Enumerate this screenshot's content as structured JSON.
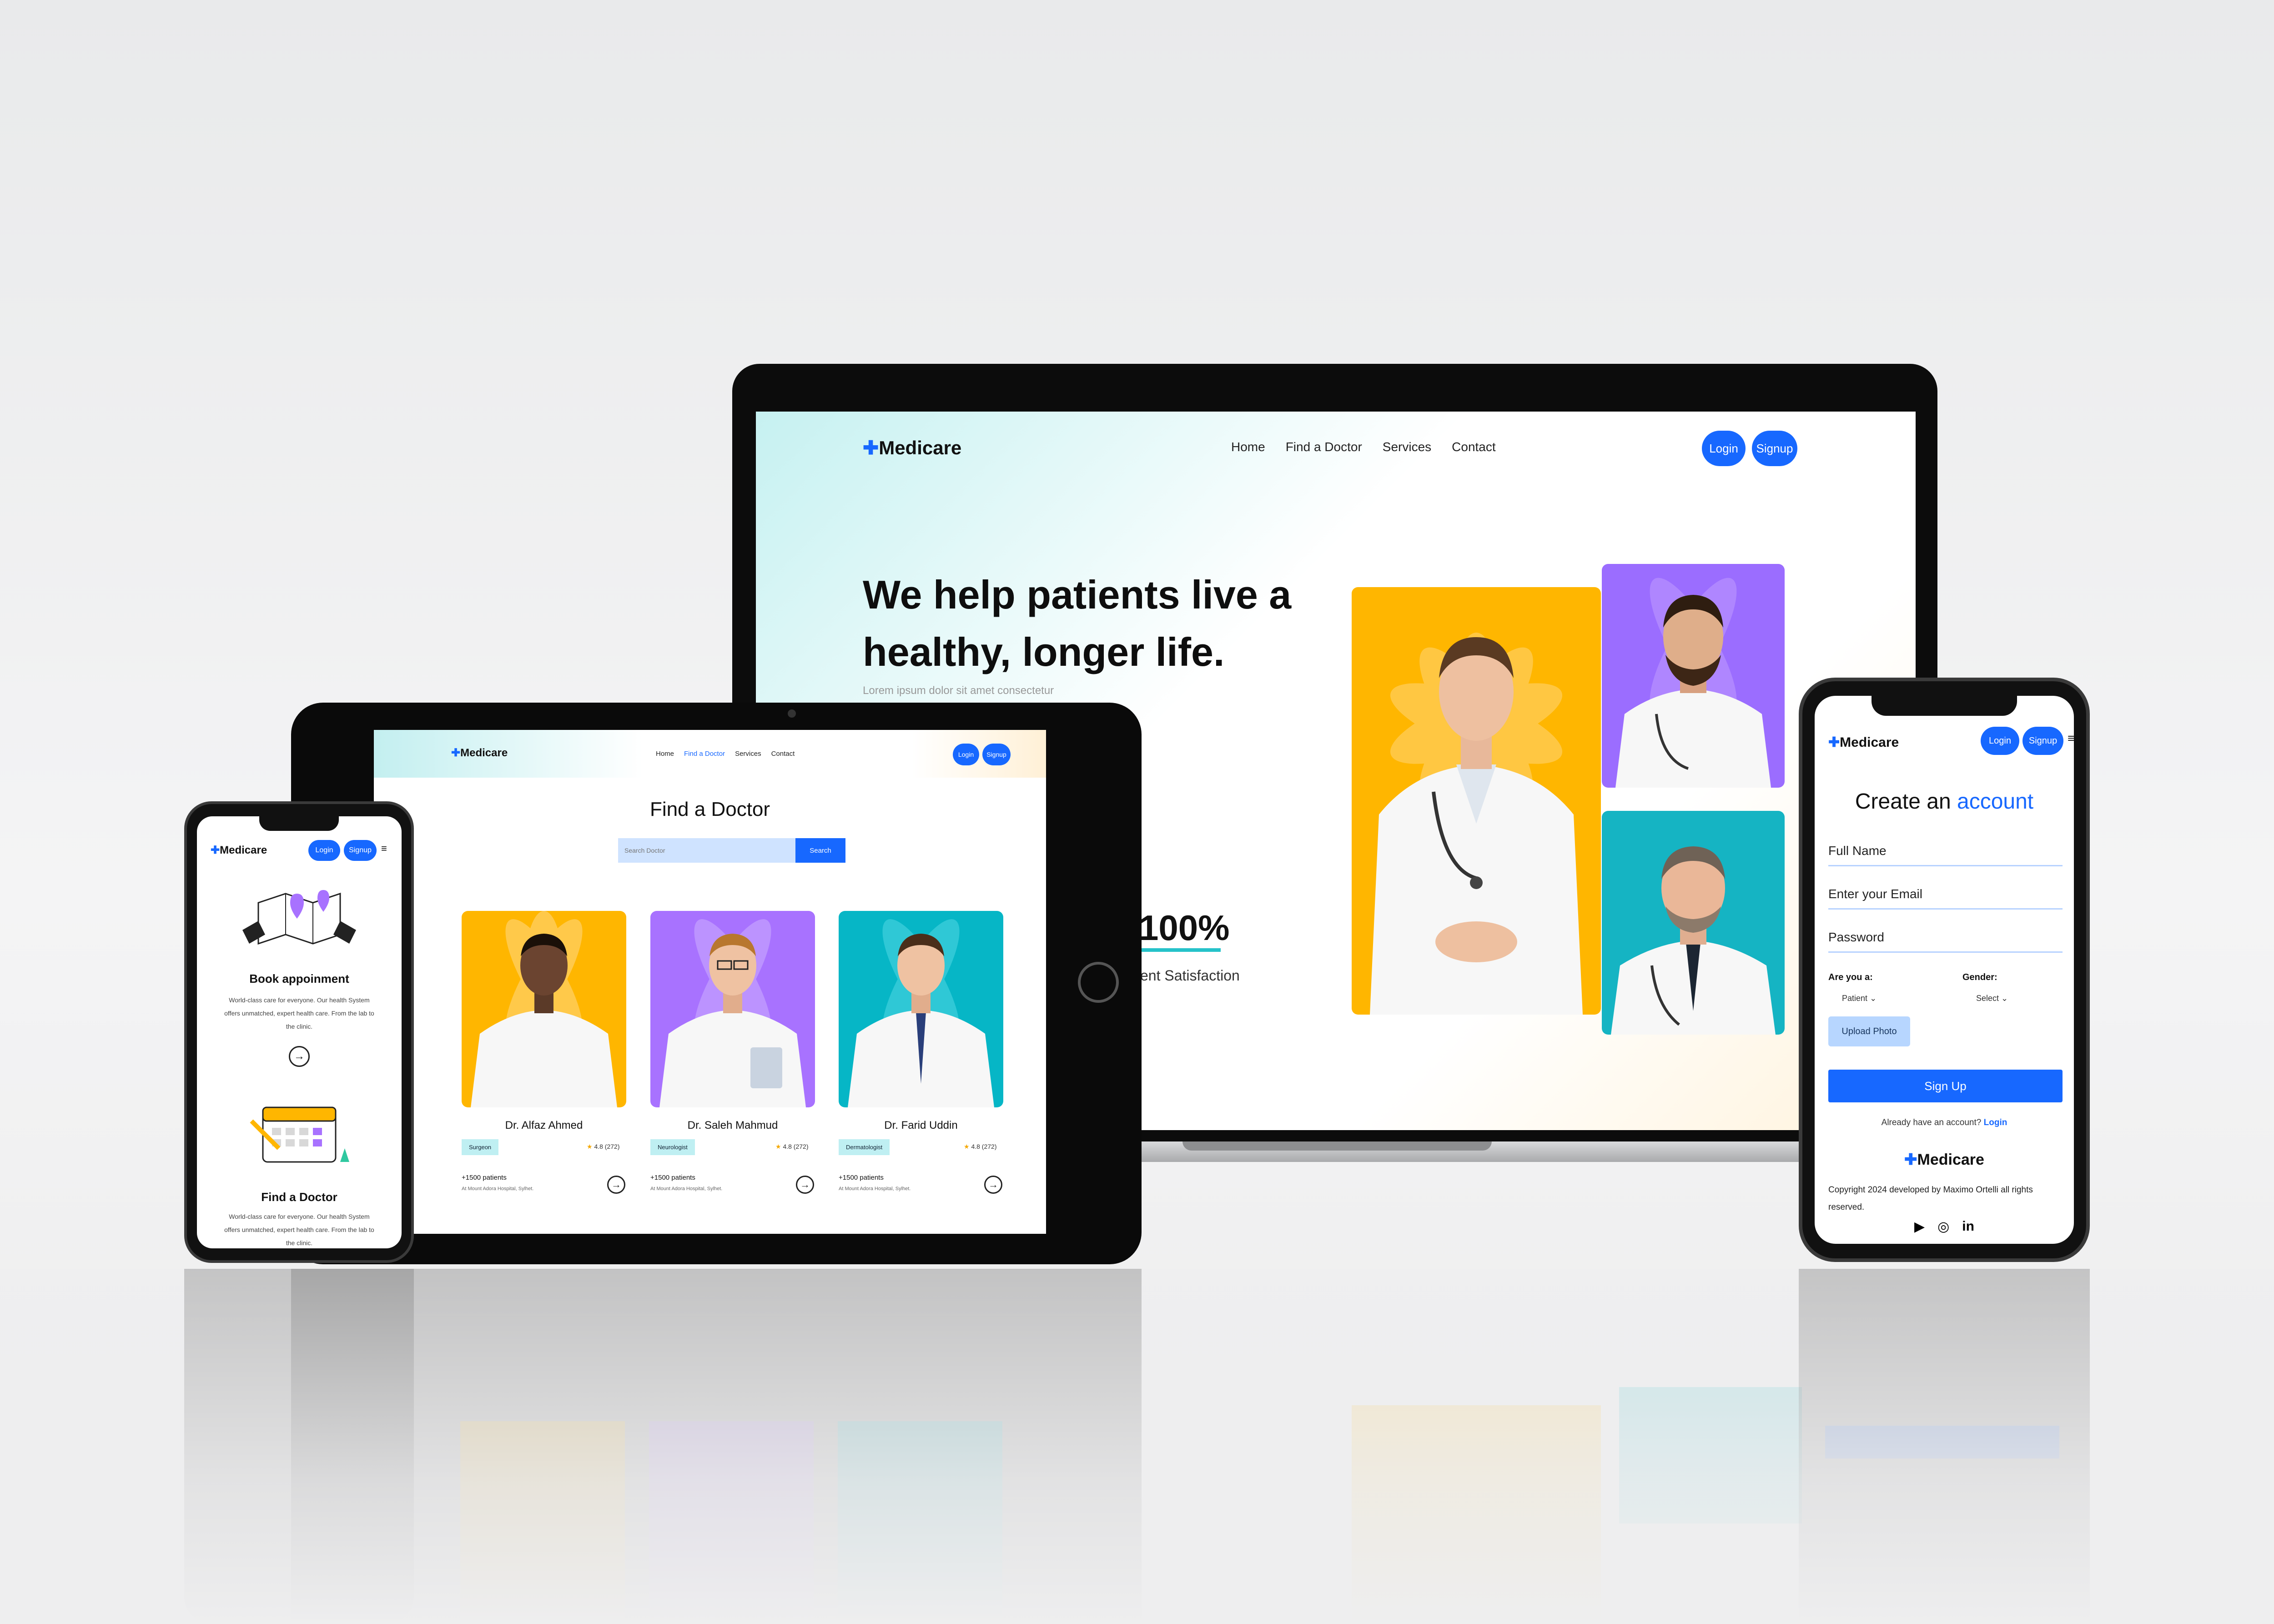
{
  "brand": {
    "name": "Medicare",
    "cross": "✚",
    "accent_color": "#1768ff",
    "teal": "#25c2c9"
  },
  "laptop": {
    "nav": [
      "Home",
      "Find a Doctor",
      "Services",
      "Contact"
    ],
    "login": "Login",
    "signup": "Signup",
    "hero_line1": "We help patients live a",
    "hero_line2": "healthy, longer life.",
    "lorem": "Lorem ipsum dolor sit amet consectetur",
    "stat_value": "100%",
    "stat_label": "ent Satisfaction"
  },
  "tablet": {
    "nav": [
      "Home",
      "Find a Doctor",
      "Services",
      "Contact"
    ],
    "login": "Login",
    "signup": "Signup",
    "title": "Find a Doctor",
    "search_placeholder": "Search Doctor",
    "search_button": "Search",
    "doctors": [
      {
        "name": "Dr. Alfaz Ahmed",
        "specialty": "Surgeon",
        "rating": "4.8 (272)",
        "patients": "+1500 patients",
        "location": "At Mount Adora Hospital, Sylhet.",
        "bg": "#ffb600"
      },
      {
        "name": "Dr. Saleh Mahmud",
        "specialty": "Neurologist",
        "rating": "4.8 (272)",
        "patients": "+1500 patients",
        "location": "At Mount Adora Hospital, Sylhet.",
        "bg": "#a872ff"
      },
      {
        "name": "Dr. Farid Uddin",
        "specialty": "Dermatologist",
        "rating": "4.8 (272)",
        "patients": "+1500 patients",
        "location": "At Mount Adora Hospital, Sylhet.",
        "bg": "#06b6c6"
      }
    ]
  },
  "phone_left": {
    "login": "Login",
    "signup": "Signup",
    "section1_title": "Book appoinment",
    "section1_text": "World-class care for everyone. Our health System offers unmatched, expert health care. From the lab to the clinic.",
    "section2_title": "Find a Doctor",
    "section2_text": "World-class care for everyone. Our health System offers unmatched, expert health care. From the lab to the clinic."
  },
  "phone_right": {
    "login": "Login",
    "signup": "Signup",
    "title_plain": "Create an ",
    "title_accent": "account",
    "full_name": "Full Name",
    "email": "Enter your Email",
    "password": "Password",
    "are_you": "Are you a:",
    "role": "Patient",
    "gender_label": "Gender:",
    "gender": "Select",
    "upload": "Upload Photo",
    "signup_button": "Sign Up",
    "already": "Already have an account?",
    "already_link": "Login",
    "copyright": "Copyright 2024 developed by Maximo Ortelli all rights reserved.",
    "social": [
      "youtube-icon",
      "instagram-icon",
      "linkedin-icon"
    ]
  }
}
